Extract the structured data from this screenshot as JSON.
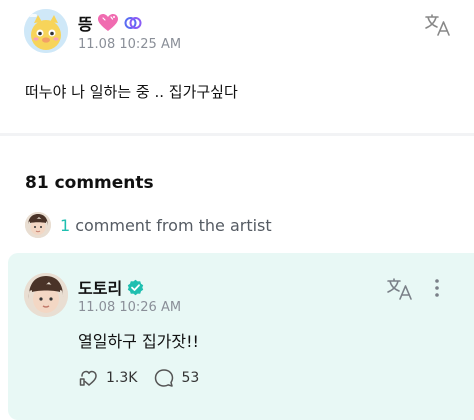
{
  "post": {
    "author": "뜽",
    "time": "11.08 10:25 AM",
    "text": "떠누야 나 일하는 중 .. 집가구싶다"
  },
  "comments": {
    "count_label": "81 comments",
    "artist_count": "1",
    "artist_label": "comment from the artist"
  },
  "artist_comment": {
    "author": "도토리",
    "time": "11.08 10:26 AM",
    "text": "열일하구 집가잣!!",
    "likes": "1.3K",
    "replies": "53"
  },
  "colors": {
    "accent": "#1fbfb0",
    "card_background": "#e8f8f5",
    "timestamp": "#8a8f98"
  },
  "icons": [
    "heart-badge-icon",
    "verified-icon",
    "translate-icon",
    "more-options-icon",
    "like-icon",
    "reply-icon"
  ]
}
